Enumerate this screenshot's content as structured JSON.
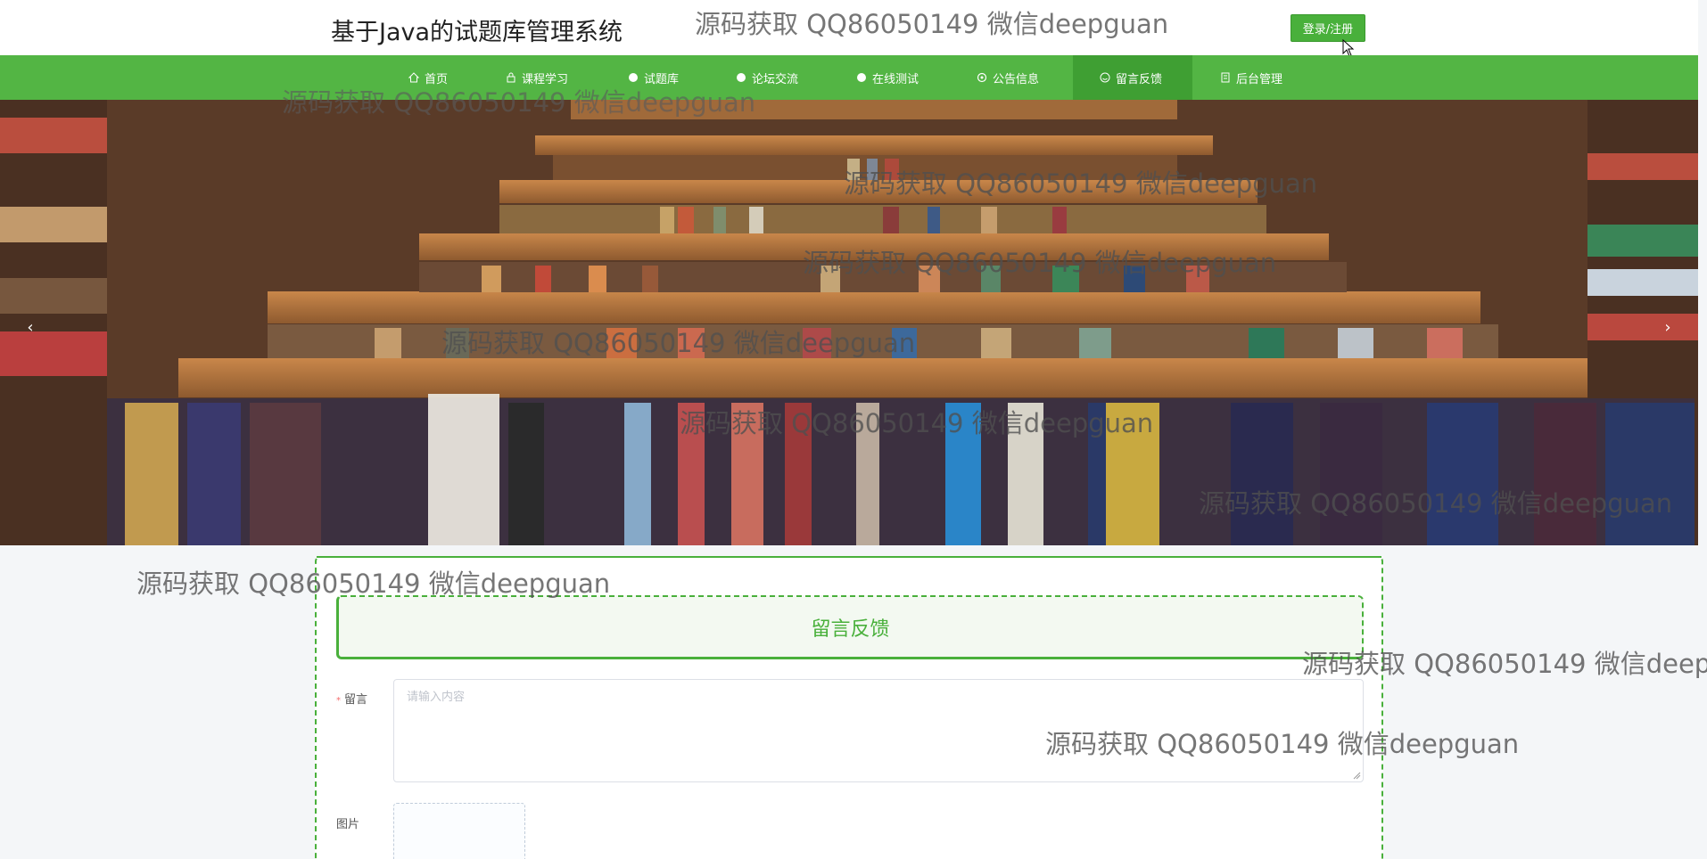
{
  "header": {
    "site_title": "基于Java的试题库管理系统",
    "login_label": "登录/注册"
  },
  "nav": {
    "items": [
      {
        "label": "首页",
        "icon": "home-icon"
      },
      {
        "label": "课程学习",
        "icon": "lock-icon"
      },
      {
        "label": "试题库",
        "icon": "info-icon"
      },
      {
        "label": "论坛交流",
        "icon": "question-icon"
      },
      {
        "label": "在线测试",
        "icon": "info-icon"
      },
      {
        "label": "公告信息",
        "icon": "settings-icon"
      },
      {
        "label": "留言反馈",
        "icon": "smile-icon"
      },
      {
        "label": "后台管理",
        "icon": "document-icon"
      }
    ],
    "active_index": 6
  },
  "banner": {
    "prev_arrow": "‹",
    "next_arrow": "›"
  },
  "form": {
    "title": "留言反馈",
    "message_label": "留言",
    "message_placeholder": "请输入内容",
    "image_label": "图片",
    "upload_plus": "+"
  },
  "watermark": {
    "text": "源码获取 QQ86050149 微信deepguan",
    "text_cut": "源码获取 QQ86050149 微信deep"
  },
  "colors": {
    "accent": "#53b544",
    "accent_dark": "#3f9f33",
    "login_button": "#49b03b"
  }
}
